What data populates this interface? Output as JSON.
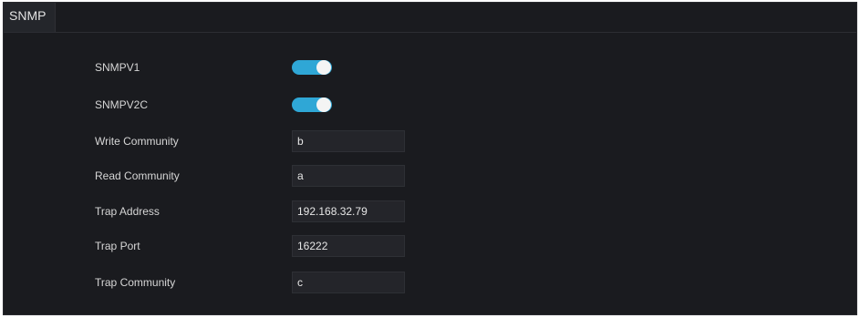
{
  "panel": {
    "tab_label": "SNMP"
  },
  "form": {
    "snmpv1": {
      "label": "SNMPV1",
      "enabled": true
    },
    "snmpv2c": {
      "label": "SNMPV2C",
      "enabled": true
    },
    "write_community": {
      "label": "Write Community",
      "value": "b"
    },
    "read_community": {
      "label": "Read Community",
      "value": "a"
    },
    "trap_address": {
      "label": "Trap Address",
      "value": "192.168.32.79"
    },
    "trap_port": {
      "label": "Trap Port",
      "value": "16222"
    },
    "trap_community": {
      "label": "Trap Community",
      "value": "c"
    }
  },
  "colors": {
    "accent": "#2fa7d6",
    "panel_bg": "#1a1b1f",
    "input_bg": "#24252a"
  }
}
